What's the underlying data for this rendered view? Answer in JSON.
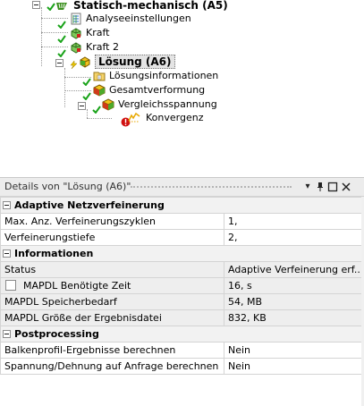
{
  "tree": {
    "root_label": "Statisch-mechanisch (A5)",
    "analysis_settings": "Analyseeinstellungen",
    "force1": "Kraft",
    "force2": "Kraft 2",
    "solution": "Lösung (A6)",
    "solution_info": "Lösungsinformationen",
    "total_deformation": "Gesamtverformung",
    "equivalent_stress": "Vergleichsspannung",
    "convergence": "Konvergenz"
  },
  "details": {
    "title": "Details von \"Lösung (A6)\"",
    "pin_glyph": "⊕",
    "max_glyph": "□",
    "close_glyph": "✕",
    "dropdown_glyph": "▾",
    "groups": {
      "adaptive": "Adaptive Netzverfeinerung",
      "info": "Informationen",
      "post": "Postprocessing"
    },
    "rows": {
      "max_cycles_label": "Max. Anz. Verfeinerungszyklen",
      "max_cycles_value": "1,",
      "depth_label": "Verfeinerungstiefe",
      "depth_value": "2,",
      "status_label": "Status",
      "status_value": "Adaptive Verfeinerung erf...",
      "time_label": "MAPDL Benötigte Zeit",
      "time_value": "16, s",
      "memory_label": "MAPDL Speicherbedarf",
      "memory_value": "54, MB",
      "filesize_label": "MAPDL Größe der Ergebnisdatei",
      "filesize_value": "832, KB",
      "beam_label": "Balkenprofil-Ergebnisse berechnen",
      "beam_value": "Nein",
      "ondemand_label": "Spannung/Dehnung auf Anfrage berechnen",
      "ondemand_value": "Nein"
    }
  },
  "colors": {
    "check_green": "#1aa31a",
    "bolt_yellow": "#e8c400",
    "error_red": "#d01010",
    "cube_green": "#4caa2a",
    "cube_yellow": "#f2c21b"
  }
}
